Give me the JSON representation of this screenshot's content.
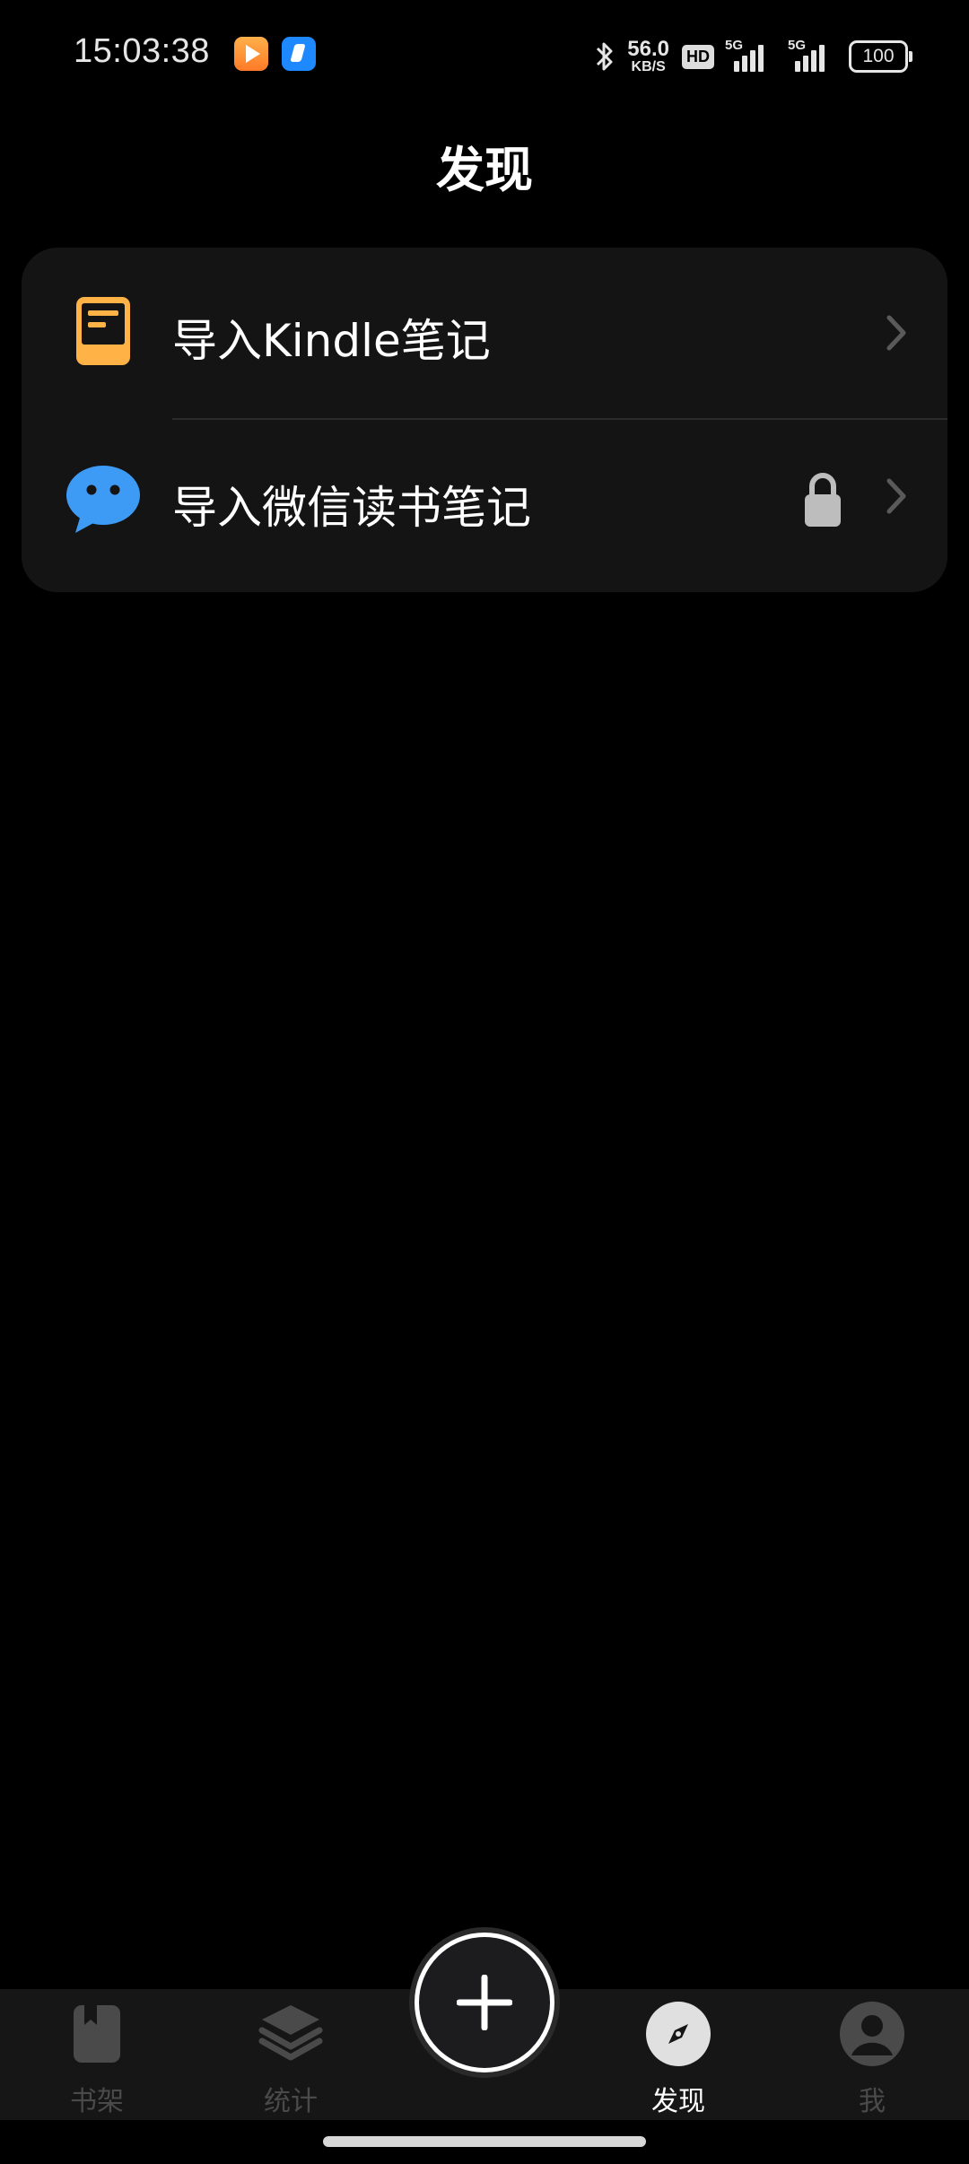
{
  "status_bar": {
    "time": "15:03:38",
    "net_speed_value": "56.0",
    "net_speed_unit": "KB/S",
    "hd_label": "HD",
    "signal_1_label": "5G",
    "signal_2_label": "5G",
    "battery": "100",
    "app_icons": [
      "video-app-icon",
      "feishu-app-icon"
    ]
  },
  "header": {
    "title": "发现"
  },
  "list": {
    "items": [
      {
        "label": "导入Kindle笔记",
        "icon": "kindle-book-icon",
        "locked": false
      },
      {
        "label": "导入微信读书笔记",
        "icon": "wechat-chat-icon",
        "locked": true
      }
    ]
  },
  "tabbar": {
    "tabs": [
      {
        "label": "书架",
        "icon": "bookmark-book-icon",
        "active": false
      },
      {
        "label": "统计",
        "icon": "layers-icon",
        "active": false
      },
      {
        "label": "发现",
        "icon": "compass-icon",
        "active": true
      },
      {
        "label": "我",
        "icon": "user-icon",
        "active": false
      }
    ],
    "fab_icon": "plus-icon"
  },
  "colors": {
    "background": "#000000",
    "card": "#141414",
    "tabbar": "#161616",
    "kindle_accent": "#FFB347",
    "wechat_accent": "#3D9BF5",
    "inactive_tab": "#4A4A4A",
    "active_tab": "#FFFFFF"
  }
}
